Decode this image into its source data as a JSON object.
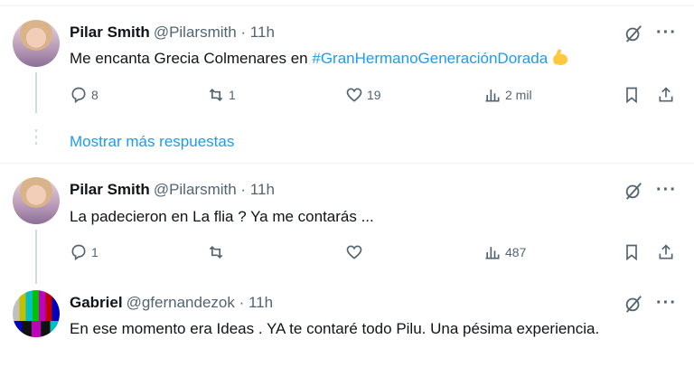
{
  "show_more_label": "Mostrar más respuestas",
  "accent_color": "#1d9bf0",
  "tweets": [
    {
      "name": "Pilar Smith",
      "handle": "@Pilarsmith · 11h",
      "text_before": "Me encanta Grecia Colmenares en ",
      "hashtag": "#GranHermanoGeneraciónDorada",
      "emoji": "flexed-biceps-emoji",
      "replies": "8",
      "retweets": "1",
      "likes": "19",
      "views": "2 mil"
    },
    {
      "name": "Pilar Smith",
      "handle": "@Pilarsmith · 11h",
      "text": "La padecieron en La flia ? Ya me contarás ...",
      "replies": "1",
      "retweets": "",
      "likes": "",
      "views": "487"
    },
    {
      "name": "Gabriel",
      "handle": "@gfernandezok · 11h",
      "text": "En ese momento era Ideas . YA te contaré todo Pilu. Una pésima experiencia."
    }
  ]
}
